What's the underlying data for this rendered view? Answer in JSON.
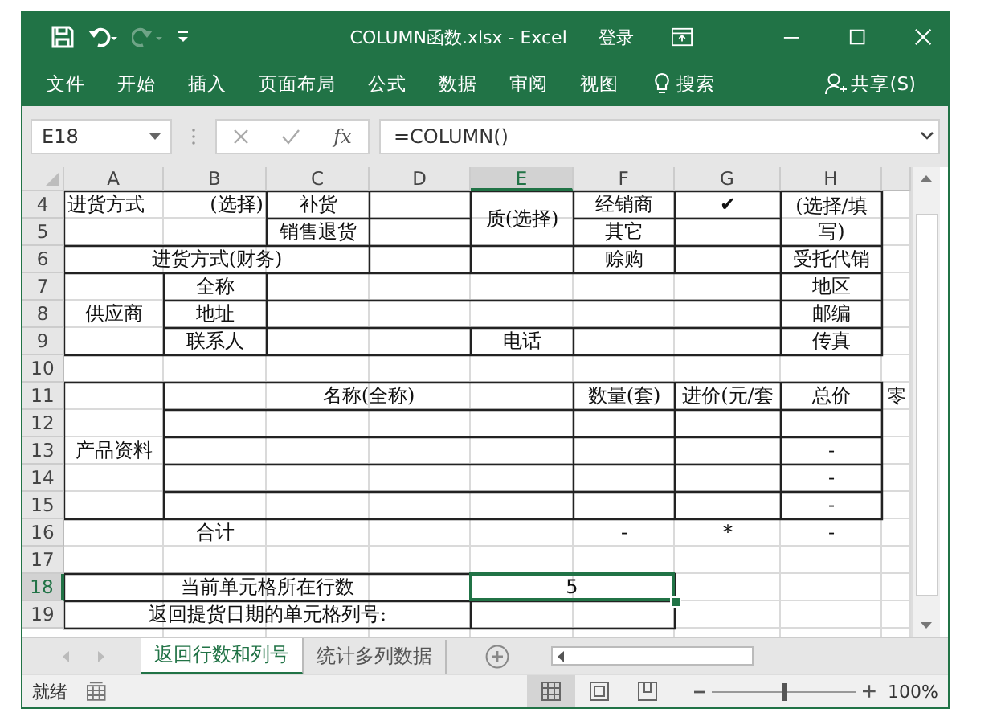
{
  "title_bar": {
    "title": "COLUMN函数.xlsx  -  Excel",
    "sign_in": "登录",
    "redo_disabled": true
  },
  "ribbon_tabs": [
    {
      "label": "文件"
    },
    {
      "label": "开始"
    },
    {
      "label": "插入"
    },
    {
      "label": "页面布局"
    },
    {
      "label": "公式"
    },
    {
      "label": "数据"
    },
    {
      "label": "审阅"
    },
    {
      "label": "视图"
    }
  ],
  "search": {
    "label": "搜索"
  },
  "share": {
    "label": "共享(S)"
  },
  "formula_bar": {
    "name_box": "E18",
    "function_label": "fx",
    "formula": "=COLUMN()"
  },
  "sheet": {
    "columns": [
      {
        "label": "A",
        "selected": false
      },
      {
        "label": "B",
        "selected": false
      },
      {
        "label": "C",
        "selected": false
      },
      {
        "label": "D",
        "selected": false
      },
      {
        "label": "E",
        "selected": true
      },
      {
        "label": "F",
        "selected": false
      },
      {
        "label": "G",
        "selected": false
      },
      {
        "label": "H",
        "selected": false
      }
    ],
    "rows": [
      {
        "label": "4",
        "selected": false,
        "cells": [
          {
            "text": "进货方式",
            "selected": false
          },
          {
            "text": "(选择)",
            "selected": false
          },
          {
            "text": "补货",
            "selected": false
          },
          {
            "text": "质(选择)",
            "selected": false
          },
          {
            "text": "经销商",
            "selected": false
          },
          {
            "text": "✔",
            "selected": false
          },
          {
            "text": "(选择/填写)",
            "selected": false
          }
        ]
      },
      {
        "label": "5",
        "selected": false,
        "cells": [
          {
            "text": "销售退货",
            "selected": false
          },
          {
            "text": "其它",
            "selected": false
          }
        ]
      },
      {
        "label": "6",
        "selected": false,
        "cells": [
          {
            "text": "进货方式(财务)",
            "selected": false
          },
          {
            "text": "赊购",
            "selected": false
          },
          {
            "text": "受托代销",
            "selected": false
          }
        ]
      },
      {
        "label": "7",
        "selected": false,
        "cells": [
          {
            "text": "供应商",
            "selected": false
          },
          {
            "text": "全称",
            "selected": false
          },
          {
            "text": "地区",
            "selected": false
          }
        ]
      },
      {
        "label": "8",
        "selected": false,
        "cells": [
          {
            "text": "地址",
            "selected": false
          },
          {
            "text": "邮编",
            "selected": false
          }
        ]
      },
      {
        "label": "9",
        "selected": false,
        "cells": [
          {
            "text": "联系人",
            "selected": false
          },
          {
            "text": "电话",
            "selected": false
          },
          {
            "text": "传真",
            "selected": false
          }
        ]
      },
      {
        "label": "10",
        "selected": false
      },
      {
        "label": "11",
        "selected": false,
        "cells": [
          {
            "text": "产品资料",
            "selected": false
          },
          {
            "text": "名称(全称)",
            "selected": false
          },
          {
            "text": "数量(套)",
            "selected": false
          },
          {
            "text": "进价(元/套",
            "selected": false
          },
          {
            "text": "总价",
            "selected": false
          },
          {
            "text": "零",
            "selected": false
          }
        ]
      },
      {
        "label": "12",
        "selected": false
      },
      {
        "label": "13",
        "selected": false,
        "cells": [
          {
            "text": "-",
            "selected": false
          }
        ]
      },
      {
        "label": "14",
        "selected": false,
        "cells": [
          {
            "text": "-",
            "selected": false
          }
        ]
      },
      {
        "label": "15",
        "selected": false,
        "cells": [
          {
            "text": "-",
            "selected": false
          }
        ]
      },
      {
        "label": "16",
        "selected": false,
        "cells": [
          {
            "text": "合计",
            "selected": false
          },
          {
            "text": "-",
            "selected": false
          },
          {
            "text": "*",
            "selected": false
          },
          {
            "text": "-",
            "selected": false
          }
        ]
      },
      {
        "label": "17",
        "selected": false
      },
      {
        "label": "18",
        "selected": true,
        "cells": [
          {
            "text": "当前单元格所在行数",
            "selected": false
          },
          {
            "text": "5",
            "selected": true
          }
        ]
      },
      {
        "label": "19",
        "selected": false,
        "cells": [
          {
            "text": "返回提货日期的单元格列号:",
            "selected": false
          }
        ]
      }
    ]
  },
  "sheet_tabs": [
    {
      "label": "返回行数和列号",
      "selected": true
    },
    {
      "label": "统计多列数据",
      "selected": false
    }
  ],
  "status_bar": {
    "status": "就绪",
    "zoom": {
      "level": 0.5,
      "reading": "100%"
    }
  }
}
